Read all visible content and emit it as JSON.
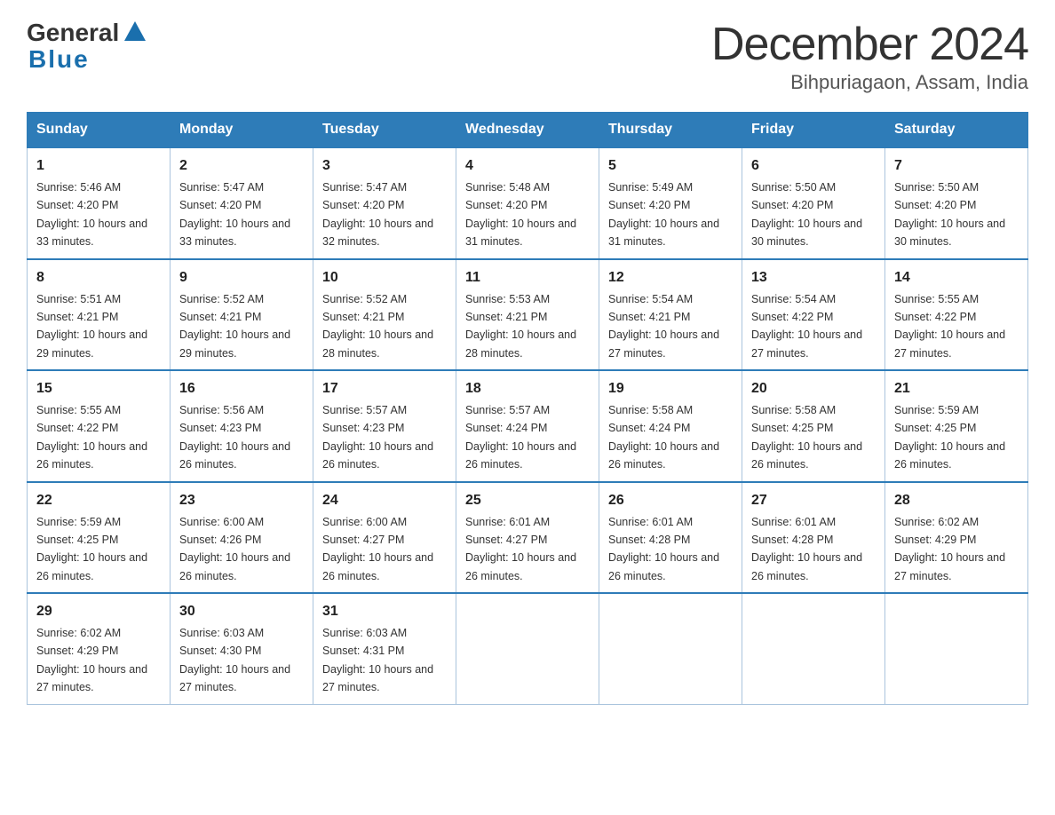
{
  "header": {
    "logo_general": "General",
    "logo_blue": "Blue",
    "month_year": "December 2024",
    "location": "Bihpuriagaon, Assam, India"
  },
  "calendar": {
    "days_of_week": [
      "Sunday",
      "Monday",
      "Tuesday",
      "Wednesday",
      "Thursday",
      "Friday",
      "Saturday"
    ],
    "weeks": [
      [
        {
          "day": "1",
          "sunrise": "5:46 AM",
          "sunset": "4:20 PM",
          "daylight": "10 hours and 33 minutes."
        },
        {
          "day": "2",
          "sunrise": "5:47 AM",
          "sunset": "4:20 PM",
          "daylight": "10 hours and 33 minutes."
        },
        {
          "day": "3",
          "sunrise": "5:47 AM",
          "sunset": "4:20 PM",
          "daylight": "10 hours and 32 minutes."
        },
        {
          "day": "4",
          "sunrise": "5:48 AM",
          "sunset": "4:20 PM",
          "daylight": "10 hours and 31 minutes."
        },
        {
          "day": "5",
          "sunrise": "5:49 AM",
          "sunset": "4:20 PM",
          "daylight": "10 hours and 31 minutes."
        },
        {
          "day": "6",
          "sunrise": "5:50 AM",
          "sunset": "4:20 PM",
          "daylight": "10 hours and 30 minutes."
        },
        {
          "day": "7",
          "sunrise": "5:50 AM",
          "sunset": "4:20 PM",
          "daylight": "10 hours and 30 minutes."
        }
      ],
      [
        {
          "day": "8",
          "sunrise": "5:51 AM",
          "sunset": "4:21 PM",
          "daylight": "10 hours and 29 minutes."
        },
        {
          "day": "9",
          "sunrise": "5:52 AM",
          "sunset": "4:21 PM",
          "daylight": "10 hours and 29 minutes."
        },
        {
          "day": "10",
          "sunrise": "5:52 AM",
          "sunset": "4:21 PM",
          "daylight": "10 hours and 28 minutes."
        },
        {
          "day": "11",
          "sunrise": "5:53 AM",
          "sunset": "4:21 PM",
          "daylight": "10 hours and 28 minutes."
        },
        {
          "day": "12",
          "sunrise": "5:54 AM",
          "sunset": "4:21 PM",
          "daylight": "10 hours and 27 minutes."
        },
        {
          "day": "13",
          "sunrise": "5:54 AM",
          "sunset": "4:22 PM",
          "daylight": "10 hours and 27 minutes."
        },
        {
          "day": "14",
          "sunrise": "5:55 AM",
          "sunset": "4:22 PM",
          "daylight": "10 hours and 27 minutes."
        }
      ],
      [
        {
          "day": "15",
          "sunrise": "5:55 AM",
          "sunset": "4:22 PM",
          "daylight": "10 hours and 26 minutes."
        },
        {
          "day": "16",
          "sunrise": "5:56 AM",
          "sunset": "4:23 PM",
          "daylight": "10 hours and 26 minutes."
        },
        {
          "day": "17",
          "sunrise": "5:57 AM",
          "sunset": "4:23 PM",
          "daylight": "10 hours and 26 minutes."
        },
        {
          "day": "18",
          "sunrise": "5:57 AM",
          "sunset": "4:24 PM",
          "daylight": "10 hours and 26 minutes."
        },
        {
          "day": "19",
          "sunrise": "5:58 AM",
          "sunset": "4:24 PM",
          "daylight": "10 hours and 26 minutes."
        },
        {
          "day": "20",
          "sunrise": "5:58 AM",
          "sunset": "4:25 PM",
          "daylight": "10 hours and 26 minutes."
        },
        {
          "day": "21",
          "sunrise": "5:59 AM",
          "sunset": "4:25 PM",
          "daylight": "10 hours and 26 minutes."
        }
      ],
      [
        {
          "day": "22",
          "sunrise": "5:59 AM",
          "sunset": "4:25 PM",
          "daylight": "10 hours and 26 minutes."
        },
        {
          "day": "23",
          "sunrise": "6:00 AM",
          "sunset": "4:26 PM",
          "daylight": "10 hours and 26 minutes."
        },
        {
          "day": "24",
          "sunrise": "6:00 AM",
          "sunset": "4:27 PM",
          "daylight": "10 hours and 26 minutes."
        },
        {
          "day": "25",
          "sunrise": "6:01 AM",
          "sunset": "4:27 PM",
          "daylight": "10 hours and 26 minutes."
        },
        {
          "day": "26",
          "sunrise": "6:01 AM",
          "sunset": "4:28 PM",
          "daylight": "10 hours and 26 minutes."
        },
        {
          "day": "27",
          "sunrise": "6:01 AM",
          "sunset": "4:28 PM",
          "daylight": "10 hours and 26 minutes."
        },
        {
          "day": "28",
          "sunrise": "6:02 AM",
          "sunset": "4:29 PM",
          "daylight": "10 hours and 27 minutes."
        }
      ],
      [
        {
          "day": "29",
          "sunrise": "6:02 AM",
          "sunset": "4:29 PM",
          "daylight": "10 hours and 27 minutes."
        },
        {
          "day": "30",
          "sunrise": "6:03 AM",
          "sunset": "4:30 PM",
          "daylight": "10 hours and 27 minutes."
        },
        {
          "day": "31",
          "sunrise": "6:03 AM",
          "sunset": "4:31 PM",
          "daylight": "10 hours and 27 minutes."
        },
        null,
        null,
        null,
        null
      ]
    ]
  }
}
